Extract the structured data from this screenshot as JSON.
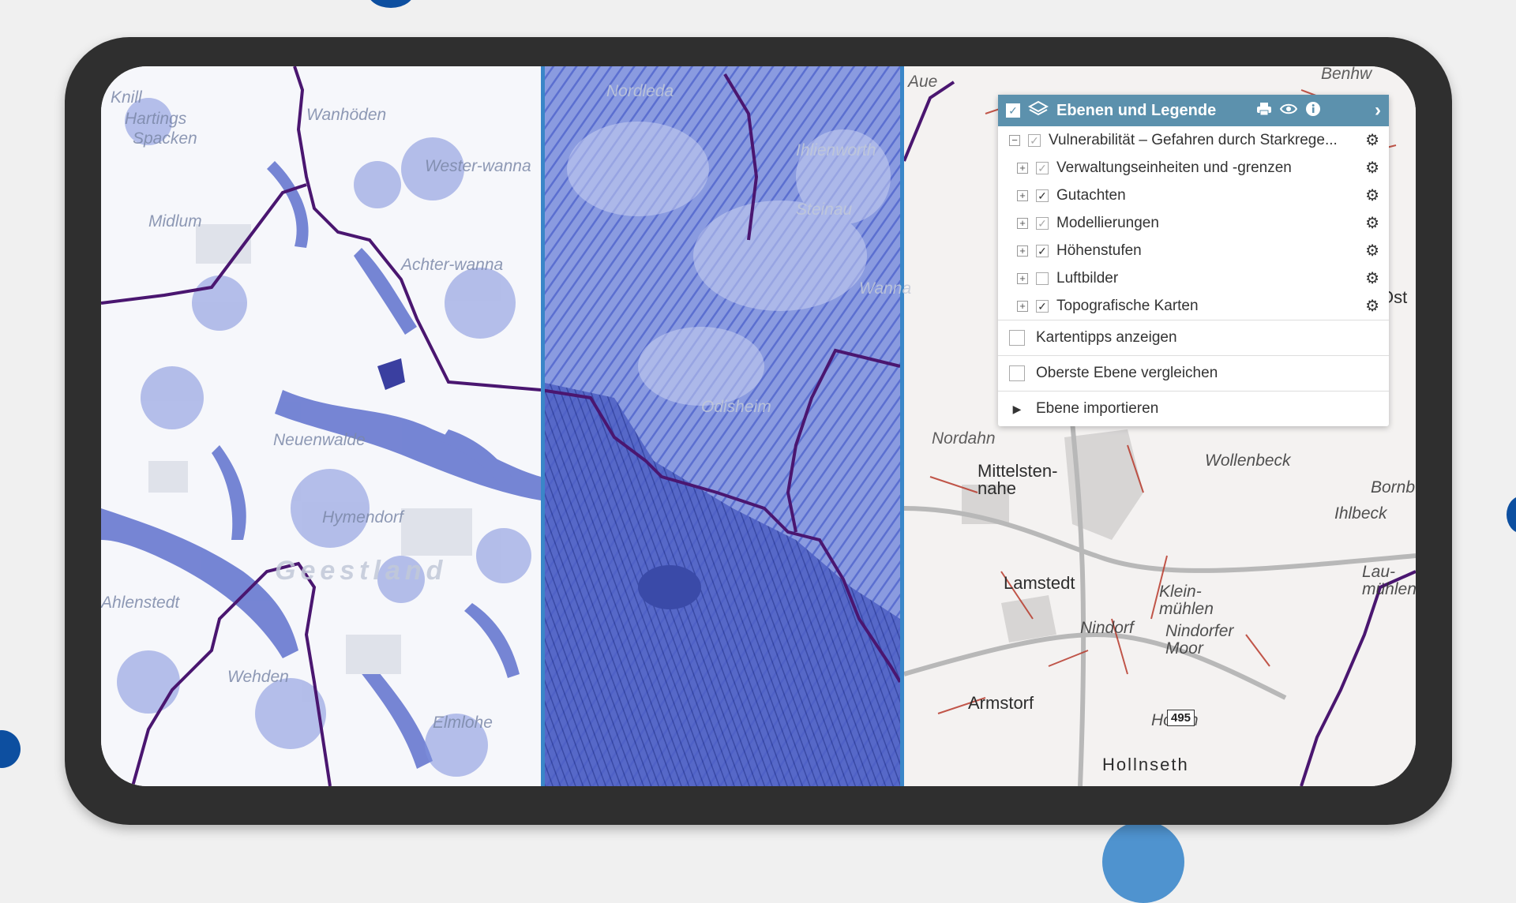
{
  "colors": {
    "accent": "#5c91ad",
    "divider": "#3a86c8",
    "boundary": "#4a1670",
    "flood": "#3a4fb8",
    "background_dot": "#0d4fa0",
    "device_frame": "#2f2f2f"
  },
  "panel": {
    "title": "Ebenen und Legende",
    "header_icons": [
      "layers-icon",
      "print-icon",
      "eye-icon",
      "info-icon",
      "chevron-right-icon"
    ],
    "root_layer": {
      "label": "Vulnerabilität – Gefahren durch Starkrege...",
      "checked": true,
      "expanded": true
    },
    "layers": [
      {
        "label": "Verwaltungseinheiten und -grenzen",
        "checked": true,
        "dim": true
      },
      {
        "label": "Gutachten",
        "checked": true,
        "dim": false
      },
      {
        "label": "Modellierungen",
        "checked": true,
        "dim": true
      },
      {
        "label": "Höhenstufen",
        "checked": true,
        "dim": false
      },
      {
        "label": "Luftbilder",
        "checked": false,
        "dim": false
      },
      {
        "label": "Topografische Karten",
        "checked": true,
        "dim": false
      }
    ],
    "option_map_tips": "Kartentipps anzeigen",
    "option_compare": "Oberste Ebene vergleichen",
    "option_import": "Ebene importieren"
  },
  "map": {
    "left_labels": [
      "Knill",
      "Hartings",
      "Spacken",
      "Wanhöden",
      "Midlum",
      "Wester-wanna",
      "Achter-wanna",
      "Neuenwalde",
      "Hymendorf",
      "Geestland",
      "Wehden",
      "Elmlohe",
      "Ahlenstedt"
    ],
    "middle_labels": [
      "Nordleda",
      "Ihlienworth",
      "Steinau",
      "Odisheim",
      "Wanna"
    ],
    "right_labels": [
      "Aue",
      "Nordahn",
      "Mittelsten-nahe",
      "Lamstedt",
      "Klein-mühlen",
      "Nindorf",
      "Nindorfer Moor",
      "Armstorf",
      "Hollen",
      "Hollnseth",
      "Wollenbeck",
      "Ihlbeck",
      "Bornb",
      "Lau-mühlen",
      "Benhw",
      "Ost"
    ],
    "road_number": "495"
  }
}
